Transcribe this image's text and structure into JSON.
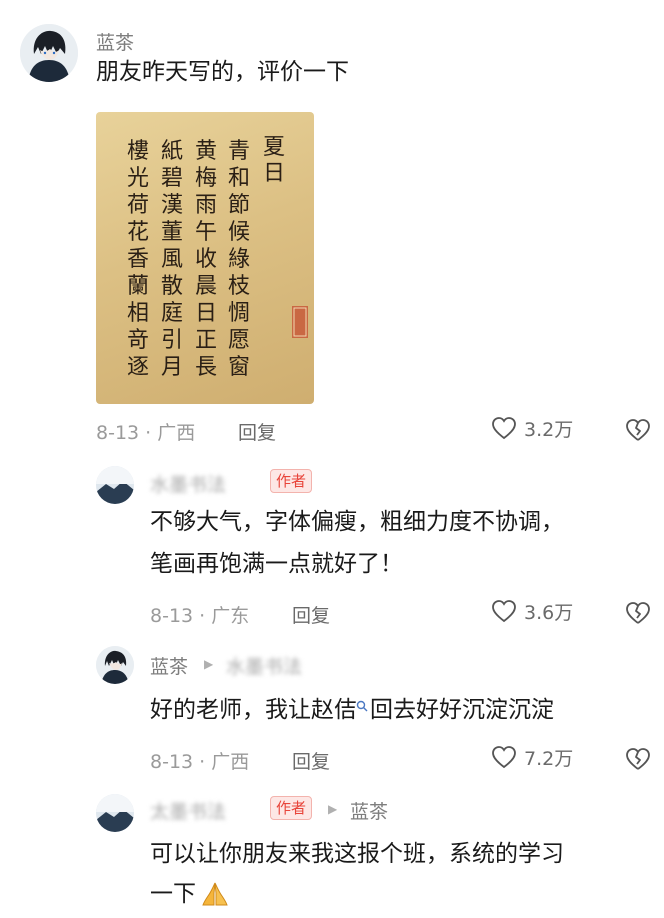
{
  "comments": [
    {
      "user": "蓝茶",
      "text": "朋友昨天写的，评价一下",
      "date_location": "8-13 · 广西",
      "reply_label": "回复",
      "likes": "3.2万"
    },
    {
      "user_obscured": "水墨书法",
      "badge": "作者",
      "text_line1": "不够大气，字体偏瘦，粗细力度不协调，",
      "text_line2": "笔画再饱满一点就好了！",
      "date_location": "8-13 · 广东",
      "reply_label": "回复",
      "likes": "3.6万"
    },
    {
      "user": "蓝茶",
      "reply_to_obscured": "水墨书法",
      "text_part1": "好的老师，我让赵佶",
      "text_part2": "回去好好沉淀沉淀",
      "date_location": "8-13 · 广西",
      "reply_label": "回复",
      "likes": "7.2万"
    },
    {
      "user_obscured": "太墨书法",
      "badge": "作者",
      "reply_to": "蓝茶",
      "text_line1": "可以让你朋友来我这报个班，系统的学习",
      "text_line2": "一下"
    }
  ],
  "calligraphy_image": {
    "title": "夏日",
    "columns": [
      "青和節候綠枝惆愿窗",
      "黄梅雨午收晨日正長",
      "紙碧漢董風散庭引月",
      "樓光荷花香蘭相竒逐"
    ]
  },
  "colors": {
    "badge_text": "#e8443a",
    "badge_bg": "#fde7e5",
    "meta": "#9a9a9a"
  }
}
